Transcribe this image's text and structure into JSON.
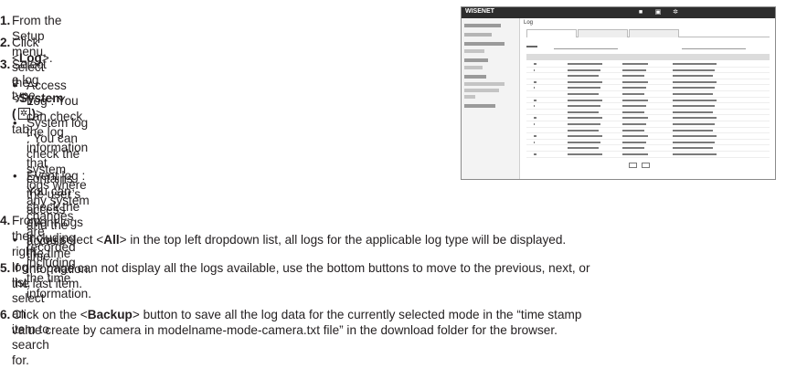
{
  "steps": {
    "s1": {
      "num": "1.",
      "a": "From the Setup menu, select the <",
      "b": "System (",
      "icon": "gear-icon",
      "c": ")",
      "d": "> tab."
    },
    "s2": {
      "num": "2.",
      "a": "Click <",
      "b": "Log",
      "c": ">."
    },
    "s3": {
      "num": "3.",
      "text": "Select a log type.",
      "bullets": [
        {
          "l1": "Access Log : You can check the log information that",
          "l2": "contains the user’s access and the access time."
        },
        {
          "l1": "System log : You can check the system logs where",
          "l2": "any system changes are recorded including the time",
          "l3": "information."
        },
        {
          "l1": "Event log : You can check the event logs including the time",
          "l2": "information."
        }
      ]
    },
    "s4": {
      "num": "4.",
      "text": "From the right log list, select an item to search for.",
      "bullet": {
        "a": "If you select <",
        "b": "All",
        "c": "> in the top left dropdown list, all logs for the applicable log type will be displayed."
      }
    },
    "s5": {
      "num": "5.",
      "l1": "If one page can not display all the logs available, use the bottom buttons to move to the previous, next, or",
      "l2": "the last item."
    },
    "s6": {
      "num": "6.",
      "l1a": "Click on the <",
      "l1b": "Backup",
      "l1c": "> button to save all the log data for the currently selected mode in the “time stamp",
      "l2": "value create by camera in modelname-mode-camera.txt file” in the download folder for the browser."
    }
  },
  "screenshot": {
    "logo": "WISENET",
    "title": "Log"
  }
}
